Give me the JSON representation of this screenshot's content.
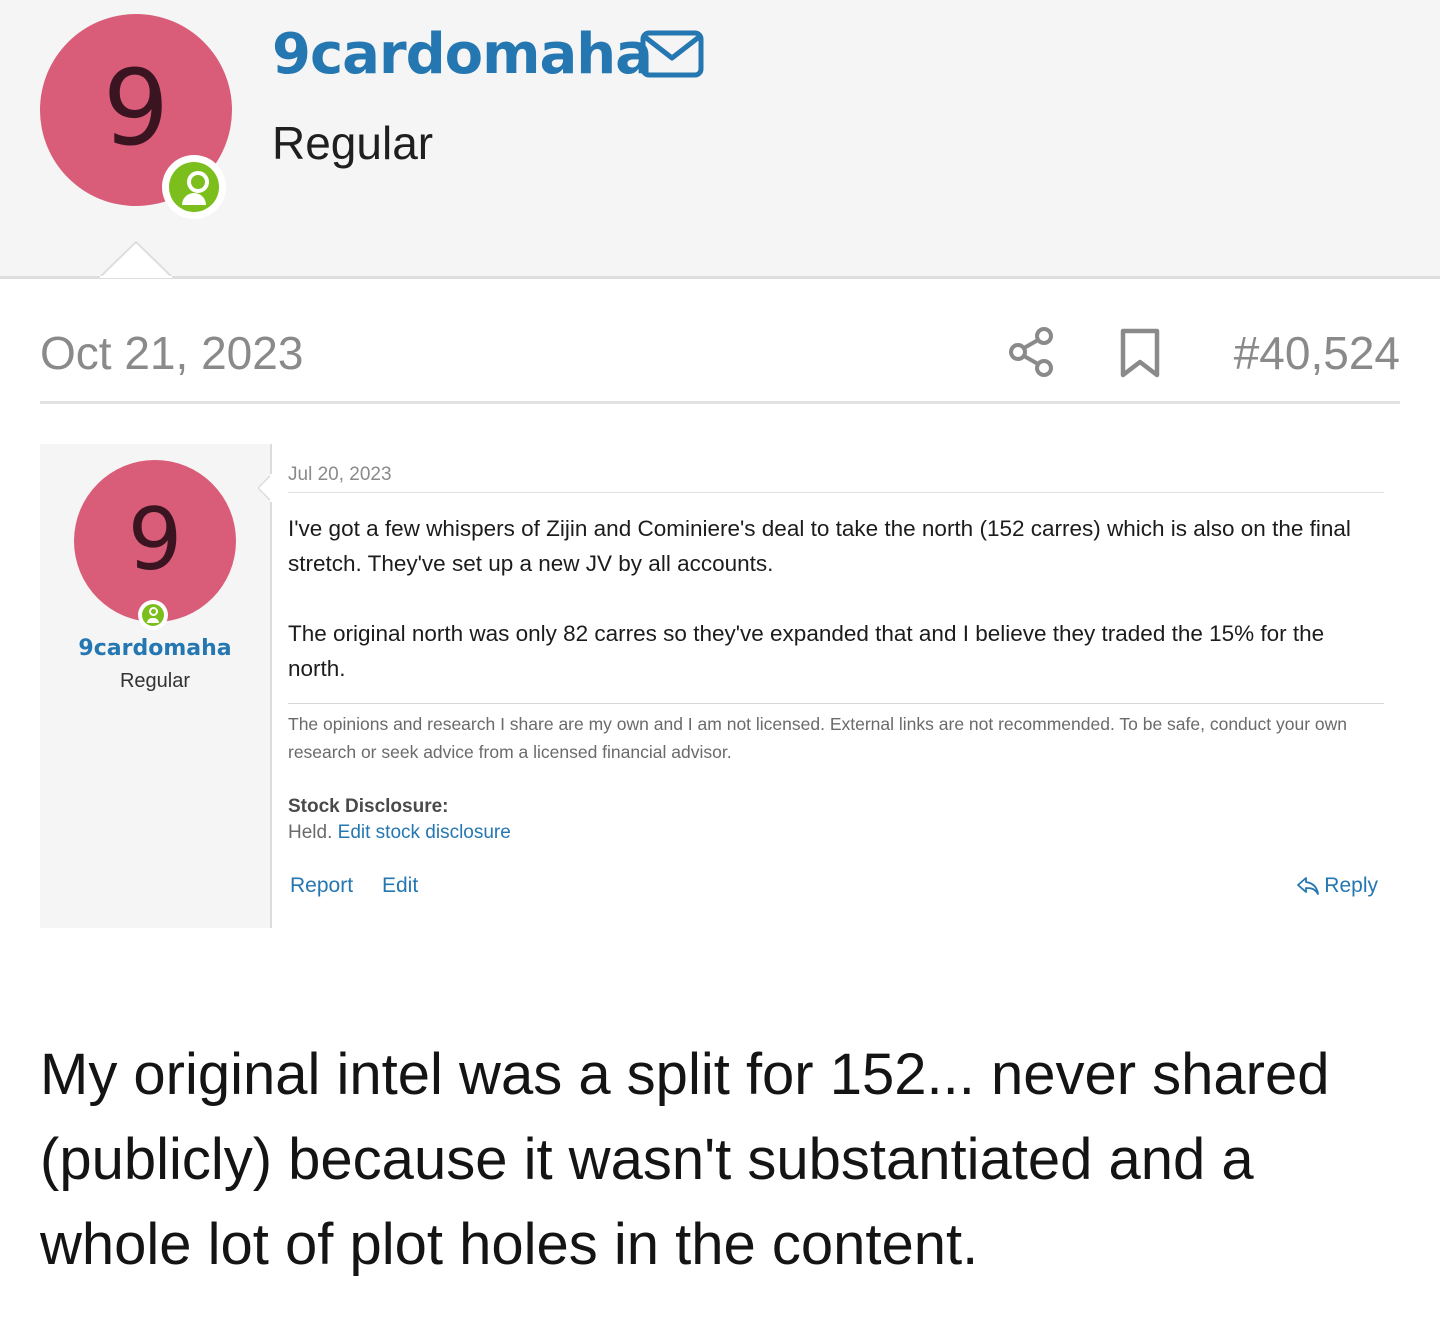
{
  "author": {
    "initial": "9",
    "username": "9cardomaha",
    "role": "Regular",
    "avatar_color": "#d95d79",
    "online_color": "#7cbf1c",
    "link_color": "#2577b1",
    "icons": [
      "envelope-icon",
      "online-user-icon"
    ]
  },
  "post": {
    "date": "Oct 21, 2023",
    "number": "#40,524",
    "icons": [
      "share-icon",
      "bookmark-icon"
    ],
    "body": "My original intel was a split for 152... never shared (publicly) because it wasn't substantiated and a whole lot of plot holes in the content."
  },
  "quoted": {
    "initial": "9",
    "username": "9cardomaha",
    "role": "Regular",
    "date": "Jul 20, 2023",
    "paragraphs": [
      "I've got a few whispers of Zijin and Cominiere's deal to take the north (152 carres) which is also on the final stretch. They've set up a new JV by all accounts.",
      "The original north was only 82 carres so they've expanded that and I believe they traded the 15% for the north."
    ],
    "signature": "The opinions and research I share are my own and I am not licensed. External links are not recommended. To be safe, conduct your own research or seek advice from a licensed financial advisor.",
    "disclosure_title": "Stock Disclosure:",
    "disclosure_value": "Held.",
    "disclosure_link": "Edit stock disclosure",
    "actions": {
      "report": "Report",
      "edit": "Edit",
      "reply": "Reply"
    }
  }
}
